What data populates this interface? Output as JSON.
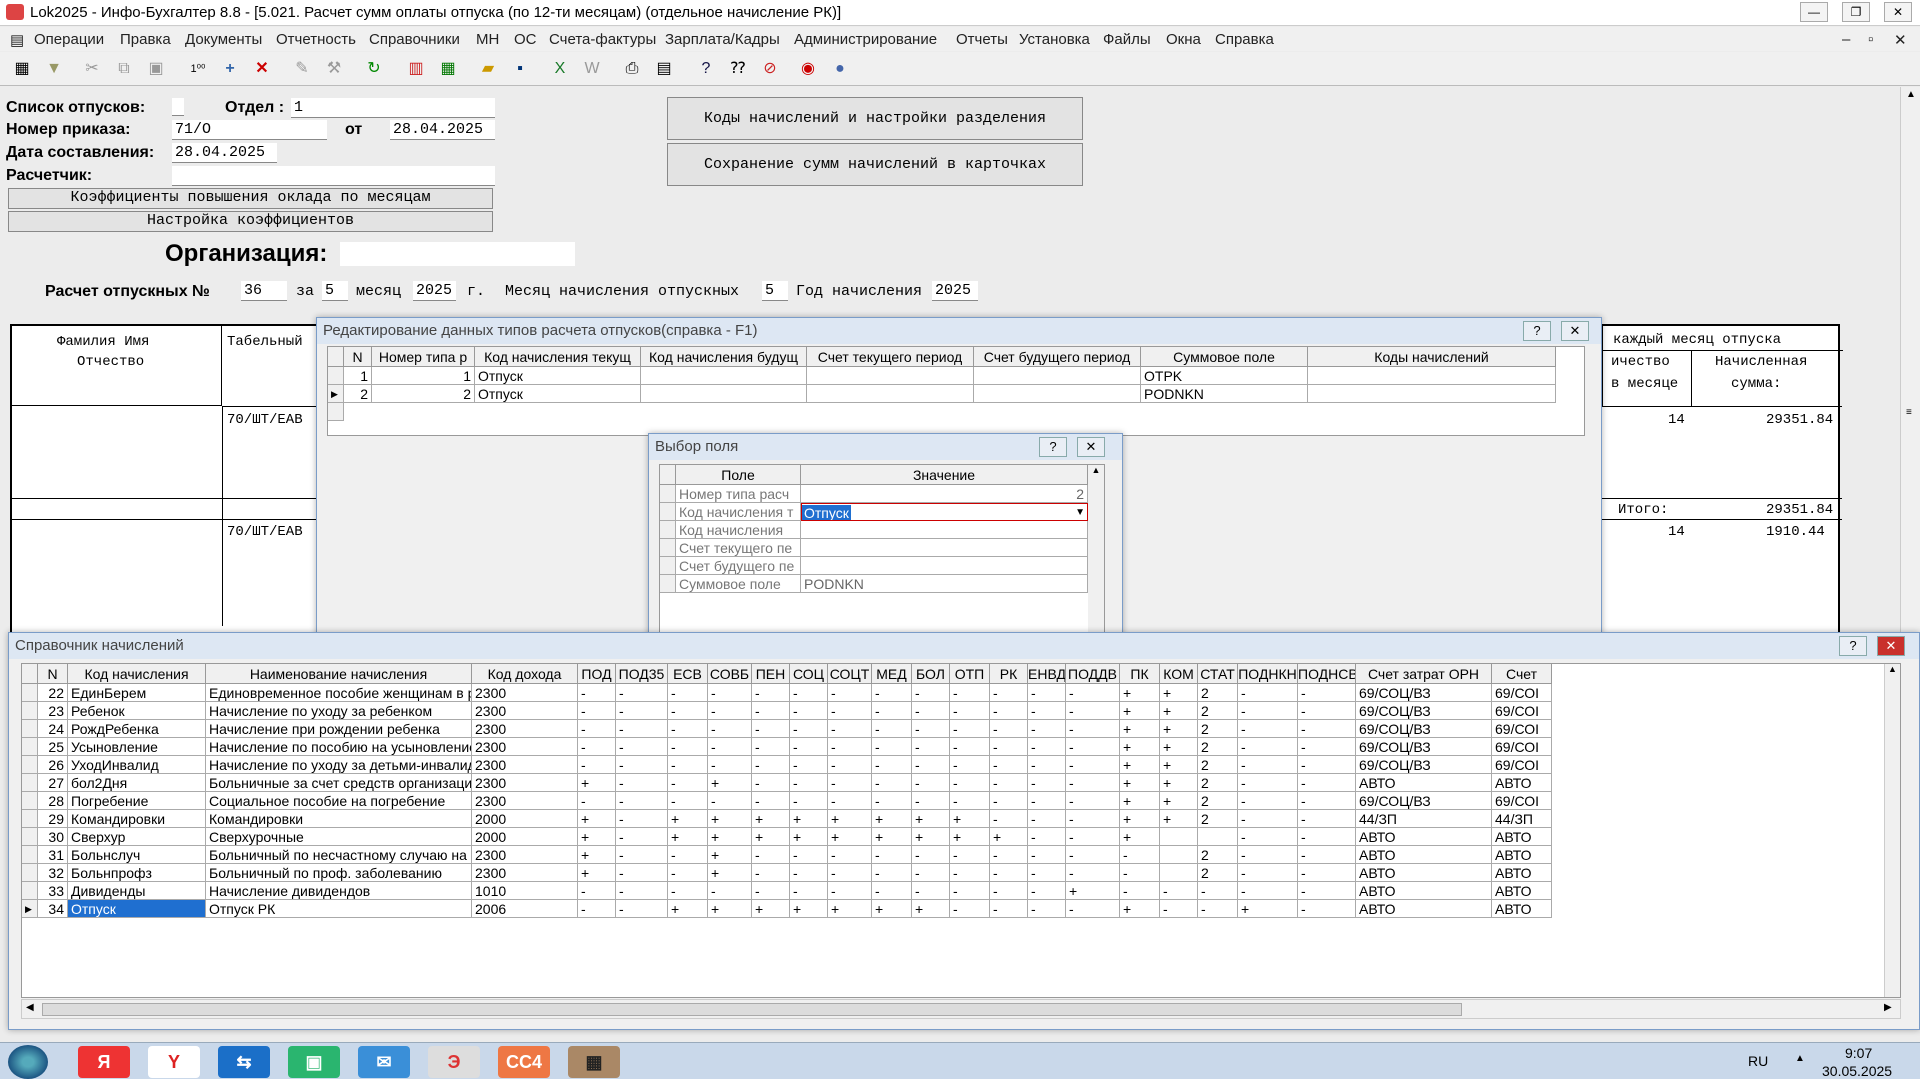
{
  "window": {
    "title": "Lok2025 - Инфо-Бухгалтер 8.8 - [5.021. Расчет сумм оплаты отпуска (по 12-ти месяцам) (отдельное начисление РК)]"
  },
  "menu": [
    "Операции",
    "Правка",
    "Документы",
    "Отчетность",
    "Справочники",
    "МН",
    "ОС",
    "Счета-фактуры",
    "Зарплата/Кадры",
    "Администрирование",
    "Отчеты",
    "Установка",
    "Файлы",
    "Окна",
    "Справка"
  ],
  "form": {
    "list_label": "Список отпусков:",
    "dept_label": "Отдел :",
    "dept_value": "1",
    "order_label": "Номер приказа:",
    "order_value": "71/О",
    "from_label": "от",
    "from_value": "28.04.2025",
    "date_label": "Дата составления:",
    "date_value": "28.04.2025",
    "calc_label": "Расчетчик:",
    "btn_coef_month": "Коэффициенты повышения оклада по месяцам",
    "btn_coef_setup": "Настройка коэффициентов",
    "btn_codes": "Коды начислений и настройки разделения",
    "btn_save": "Сохранение сумм начислений в карточках",
    "org_label": "Организация:",
    "calc_no_label": "Расчет отпускных №",
    "calc_no": "36",
    "for_label": "за",
    "month": "5",
    "month_label": "месяц",
    "year": "2025",
    "year_label": "г.",
    "accrual_month_label": "Месяц начисления отпускных",
    "accrual_month": "5",
    "accrual_year_label": "Год начисления",
    "accrual_year": "2025"
  },
  "report": {
    "col_fio_1": "Фамилия Имя",
    "col_fio_2": "Отчество",
    "col_tab": "Табельный",
    "col_month_head": "каждый месяц отпуска",
    "col_qty_1": "ичество",
    "col_qty_2": "в месяце",
    "col_sum_1": "Начисленная",
    "col_sum_2": "сумма:",
    "row1_tab": "70/ШТ/ЕАВ",
    "row1_qty": "14",
    "row1_sum": "29351.84",
    "total_label": "Итого:",
    "total_sum": "29351.84",
    "row2_tab": "70/ШТ/ЕАВ",
    "row2_qty": "14",
    "row2_sum": "1910.44"
  },
  "edit_dialog": {
    "title": "Редактирование данных типов расчета отпусков(справка - F1)",
    "help": "?",
    "close": "✕",
    "columns": [
      "N",
      "Номер типа р",
      "Код начисления текущ",
      "Код начисления будущ",
      "Счет текущего период",
      "Счет будущего период",
      "Суммовое поле",
      "Коды начислений"
    ],
    "rows": [
      {
        "n": "1",
        "type": "1",
        "cur": "Отпуск",
        "fut": "",
        "acc_cur": "",
        "acc_fut": "",
        "sum": "OTPK",
        "codes": ""
      },
      {
        "n": "2",
        "type": "2",
        "cur": "Отпуск",
        "fut": "",
        "acc_cur": "",
        "acc_fut": "",
        "sum": "PODNKN",
        "codes": ""
      }
    ]
  },
  "field_dialog": {
    "title": "Выбор поля",
    "help": "?",
    "close": "✕",
    "col_field": "Поле",
    "col_value": "Значение",
    "rows": [
      {
        "field": "Номер типа расч",
        "value": "2"
      },
      {
        "field": "Код начисления т",
        "value": "Отпуск"
      },
      {
        "field": "Код начисления",
        "value": ""
      },
      {
        "field": "Счет текущего пе",
        "value": ""
      },
      {
        "field": "Счет будущего пе",
        "value": ""
      },
      {
        "field": "Суммовое поле",
        "value": "PODNKN"
      }
    ]
  },
  "accruals": {
    "title": "Справочник начислений",
    "help": "?",
    "close": "✕",
    "columns": [
      "N",
      "Код начисления",
      "Наименование начисления",
      "Код дохода",
      "ПОД",
      "ПОД35",
      "ЕСВ",
      "СОВБ",
      "ПЕН",
      "СОЦ",
      "СОЦТ",
      "МЕД",
      "БОЛ",
      "ОТП",
      "РК",
      "ЕНВД",
      "ПОДДВ",
      "ПК",
      "КОМ",
      "СТАТ",
      "ПОДНКН",
      "ПОДНСВ",
      "Счет затрат ОРН",
      "Счет"
    ],
    "rows": [
      [
        "22",
        "ЕдинБерем",
        "Единовременное пособие женщинам в ранние",
        "2300",
        "-",
        "-",
        "-",
        "-",
        "-",
        "-",
        "-",
        "-",
        "-",
        "-",
        "-",
        "-",
        "-",
        "+",
        "+",
        "2",
        "-",
        "-",
        "69/СОЦ/ВЗ",
        "69/СОІ"
      ],
      [
        "23",
        "Ребенок",
        "Начисление по уходу за ребенком",
        "2300",
        "-",
        "-",
        "-",
        "-",
        "-",
        "-",
        "-",
        "-",
        "-",
        "-",
        "-",
        "-",
        "-",
        "+",
        "+",
        "2",
        "-",
        "-",
        "69/СОЦ/ВЗ",
        "69/СОІ"
      ],
      [
        "24",
        "РождРебенка",
        "Начисление при рождении ребенка",
        "2300",
        "-",
        "-",
        "-",
        "-",
        "-",
        "-",
        "-",
        "-",
        "-",
        "-",
        "-",
        "-",
        "-",
        "+",
        "+",
        "2",
        "-",
        "-",
        "69/СОЦ/ВЗ",
        "69/СОІ"
      ],
      [
        "25",
        "Усыновление",
        "Начисление по пособию на усыновление реб",
        "2300",
        "-",
        "-",
        "-",
        "-",
        "-",
        "-",
        "-",
        "-",
        "-",
        "-",
        "-",
        "-",
        "-",
        "+",
        "+",
        "2",
        "-",
        "-",
        "69/СОЦ/ВЗ",
        "69/СОІ"
      ],
      [
        "26",
        "УходИнвалид",
        "Начисление по уходу за детьми-инвалидами",
        "2300",
        "-",
        "-",
        "-",
        "-",
        "-",
        "-",
        "-",
        "-",
        "-",
        "-",
        "-",
        "-",
        "-",
        "+",
        "+",
        "2",
        "-",
        "-",
        "69/СОЦ/ВЗ",
        "69/СОІ"
      ],
      [
        "27",
        "бол2Дня",
        "Больничные за счет средств организации",
        "2300",
        "+",
        "-",
        "-",
        "+",
        "-",
        "-",
        "-",
        "-",
        "-",
        "-",
        "-",
        "-",
        "-",
        "+",
        "+",
        "2",
        "-",
        "-",
        "АВТО",
        "АВТО"
      ],
      [
        "28",
        "Погребение",
        "Социальное пособие на погребение",
        "2300",
        "-",
        "-",
        "-",
        "-",
        "-",
        "-",
        "-",
        "-",
        "-",
        "-",
        "-",
        "-",
        "-",
        "+",
        "+",
        "2",
        "-",
        "-",
        "69/СОЦ/ВЗ",
        "69/СОІ"
      ],
      [
        "29",
        "Командировки",
        "Командировки",
        "2000",
        "+",
        "-",
        "+",
        "+",
        "+",
        "+",
        "+",
        "+",
        "+",
        "+",
        "-",
        "-",
        "-",
        "+",
        "+",
        "2",
        "-",
        "-",
        "44/ЗП",
        "44/ЗП"
      ],
      [
        "30",
        "Сверхур",
        "Сверхурочные",
        "2000",
        "+",
        "-",
        "+",
        "+",
        "+",
        "+",
        "+",
        "+",
        "+",
        "+",
        "+",
        "-",
        "-",
        "+",
        "",
        "",
        "-",
        "-",
        "АВТО",
        "АВТО"
      ],
      [
        "31",
        "Больнслуч",
        "Больничный по несчастному случаю на пр.",
        "2300",
        "+",
        "-",
        "-",
        "+",
        "-",
        "-",
        "-",
        "-",
        "-",
        "-",
        "-",
        "-",
        "-",
        "-",
        "",
        "2",
        "-",
        "-",
        "АВТО",
        "АВТО"
      ],
      [
        "32",
        "Больнпрофз",
        "Больничный по проф. заболеванию",
        "2300",
        "+",
        "-",
        "-",
        "+",
        "-",
        "-",
        "-",
        "-",
        "-",
        "-",
        "-",
        "-",
        "-",
        "-",
        "",
        "2",
        "-",
        "-",
        "АВТО",
        "АВТО"
      ],
      [
        "33",
        "Дивиденды",
        "Начисление дивидендов",
        "1010",
        "-",
        "-",
        "-",
        "-",
        "-",
        "-",
        "-",
        "-",
        "-",
        "-",
        "-",
        "-",
        "+",
        "-",
        "-",
        "-",
        "-",
        "-",
        "АВТО",
        "АВТО"
      ],
      [
        "34",
        "Отпуск",
        "Отпуск РК",
        "2006",
        "-",
        "-",
        "+",
        "+",
        "+",
        "+",
        "+",
        "+",
        "+",
        "-",
        "-",
        "-",
        "-",
        "+",
        "-",
        "-",
        "+",
        "-",
        "АВТО",
        "АВТО"
      ]
    ]
  },
  "taskbar": {
    "lang": "RU",
    "time": "9:07",
    "date": "30.05.2025"
  }
}
